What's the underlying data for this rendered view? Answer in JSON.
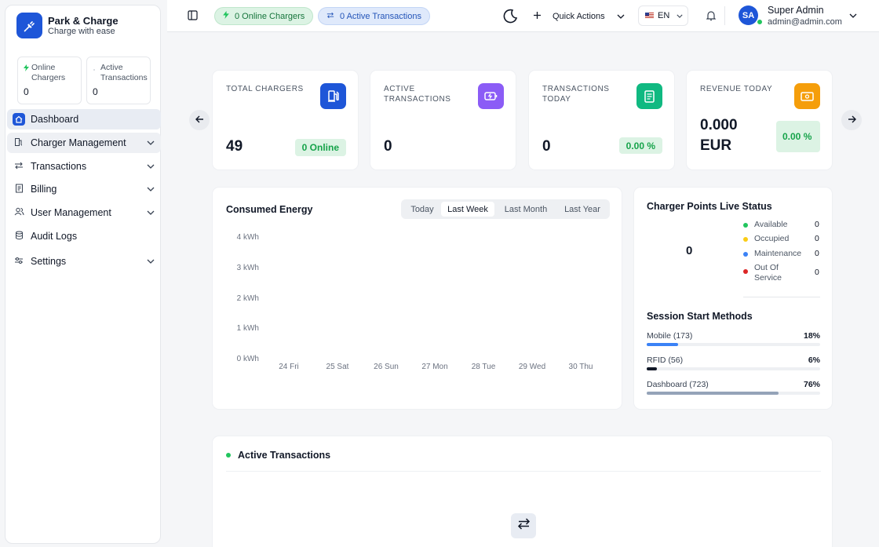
{
  "brand": {
    "name": "Park & Charge",
    "tagline": "Charge with ease"
  },
  "sidebar": {
    "mini_cards": [
      {
        "label": "Online Chargers",
        "value": "0"
      },
      {
        "label": "Active Transactions",
        "value": "0"
      }
    ],
    "nav": [
      {
        "label": "Dashboard",
        "icon": "home-icon"
      },
      {
        "label": "Charger Management",
        "icon": "fuel-pump-icon"
      },
      {
        "label": "Transactions",
        "icon": "transfer-icon"
      },
      {
        "label": "Billing",
        "icon": "receipt-icon"
      },
      {
        "label": "User Management",
        "icon": "users-icon"
      },
      {
        "label": "Audit Logs",
        "icon": "database-icon"
      },
      {
        "label": "Settings",
        "icon": "sliders-icon"
      }
    ]
  },
  "header": {
    "online_pill": "0 Online Chargers",
    "transactions_pill": "0 Active Transactions",
    "quick_actions": "Quick Actions",
    "language": "EN",
    "user_initials": "SA",
    "user_name": "Super Admin",
    "user_email": "admin@admin.com"
  },
  "stats": [
    {
      "title": "TOTAL CHARGERS",
      "value": "49",
      "badge": "0 Online",
      "color": "#1e56d8"
    },
    {
      "title": "ACTIVE TRANSACTIONS",
      "value": "0",
      "badge": "",
      "color": "#8b5cf6"
    },
    {
      "title": "TRANSACTIONS TODAY",
      "value": "0",
      "badge": "0.00 %",
      "color": "#10b981"
    },
    {
      "title": "REVENUE TODAY",
      "value": "0.000 EUR",
      "badge": "0.00 %",
      "color": "#f59e0b"
    }
  ],
  "energy": {
    "title": "Consumed Energy",
    "tabs": [
      "Today",
      "Last Week",
      "Last Month",
      "Last Year"
    ],
    "active_tab": "Last Week"
  },
  "chart_data": {
    "type": "bar",
    "title": "Consumed Energy",
    "categories": [
      "24 Fri",
      "25 Sat",
      "26 Sun",
      "27 Mon",
      "28 Tue",
      "29 Wed",
      "30 Thu"
    ],
    "values": [
      0,
      0,
      0,
      0,
      0,
      0,
      0
    ],
    "y_ticks": [
      "0 kWh",
      "1 kWh",
      "2 kWh",
      "3 kWh",
      "4 kWh"
    ],
    "ylim": [
      0,
      4
    ],
    "grid": false
  },
  "live_status": {
    "title": "Charger Points Live Status",
    "total": "0",
    "items": [
      {
        "label": "Available",
        "value": "0",
        "color": "#22c55e"
      },
      {
        "label": "Occupied",
        "value": "0",
        "color": "#facc15"
      },
      {
        "label": "Maintenance",
        "value": "0",
        "color": "#3b82f6"
      },
      {
        "label": "Out Of Service",
        "value": "0",
        "color": "#dc2626"
      }
    ]
  },
  "session_methods": {
    "title": "Session Start Methods",
    "items": [
      {
        "label": "Mobile (173)",
        "percent": "18%",
        "fraction": 0.18,
        "color": "#3b82f6"
      },
      {
        "label": "RFID (56)",
        "percent": "6%",
        "fraction": 0.06,
        "color": "#111827"
      },
      {
        "label": "Dashboard (723)",
        "percent": "76%",
        "fraction": 0.76,
        "color": "#94a3b8"
      }
    ]
  },
  "active_transactions": {
    "title": "Active Transactions"
  }
}
